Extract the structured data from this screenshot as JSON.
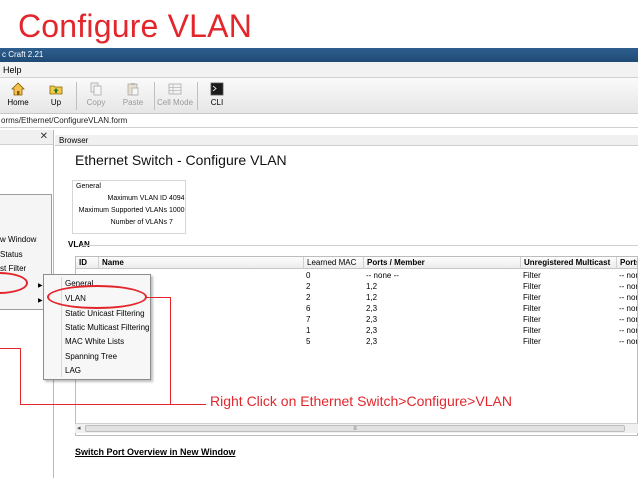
{
  "slide": {
    "title": "Configure VLAN"
  },
  "app": {
    "title": "c Craft 2.21",
    "menu": [
      "Help"
    ]
  },
  "toolbar": {
    "buttons": [
      {
        "label": "Home",
        "icon": "house-icon",
        "enabled": true
      },
      {
        "label": "Up",
        "icon": "folder-up-icon",
        "enabled": true
      },
      {
        "label": "Copy",
        "icon": "copy-icon",
        "enabled": false
      },
      {
        "label": "Paste",
        "icon": "paste-icon",
        "enabled": false
      },
      {
        "label": "Cell Mode",
        "icon": "cell-mode-icon",
        "enabled": false
      },
      {
        "label": "CLI",
        "icon": "terminal-icon",
        "enabled": true
      }
    ]
  },
  "address": {
    "path": "orms/Ethernet/ConfigureVLAN.form"
  },
  "left_pane": {
    "close_symbol": "✕"
  },
  "browser_tab": {
    "label": "Browser"
  },
  "page": {
    "title": "Ethernet Switch - Configure VLAN"
  },
  "general": {
    "legend": "General",
    "rows": [
      {
        "label": "Maximum VLAN ID",
        "value": "4094"
      },
      {
        "label": "Maximum Supported VLANs",
        "value": "1000"
      },
      {
        "label": "Number of VLANs",
        "value": "7"
      }
    ]
  },
  "vlan": {
    "label": "VLAN",
    "columns": [
      "ID",
      "Name",
      "Learned MAC",
      "Ports / Member",
      "Unregistered Multicast",
      "Ports"
    ],
    "rows": [
      {
        "learned": "0",
        "ports": "-- none --",
        "unreg": "Filter",
        "ports2": "-- none"
      },
      {
        "learned": "2",
        "ports": "1,2",
        "unreg": "Filter",
        "ports2": "-- none"
      },
      {
        "learned": "2",
        "ports": "1,2",
        "unreg": "Filter",
        "ports2": "-- none"
      },
      {
        "learned": "6",
        "ports": "2,3",
        "unreg": "Filter",
        "ports2": "-- none"
      },
      {
        "learned": "7",
        "ports": "2,3",
        "unreg": "Filter",
        "ports2": "-- none"
      },
      {
        "learned": "1",
        "ports": "2,3",
        "unreg": "Filter",
        "ports2": "-- none"
      },
      {
        "learned": "5",
        "ports": "2,3",
        "unreg": "Filter",
        "ports2": "-- none"
      }
    ]
  },
  "context_menu_1": {
    "items": [
      "w Window",
      "Status",
      "st Filter"
    ]
  },
  "context_menu_2": {
    "items": [
      "General",
      "VLAN",
      "Static Unicast Filtering",
      "Static Multicast Filtering",
      "MAC White Lists",
      "Spanning Tree",
      "LAG"
    ]
  },
  "links": {
    "overview": "Switch Port Overview in New Window"
  },
  "annotation": {
    "text": "Right Click on Ethernet Switch>Configure>VLAN"
  },
  "colors": {
    "accent": "#e3262c",
    "titlebar": "#2f5f8f"
  }
}
